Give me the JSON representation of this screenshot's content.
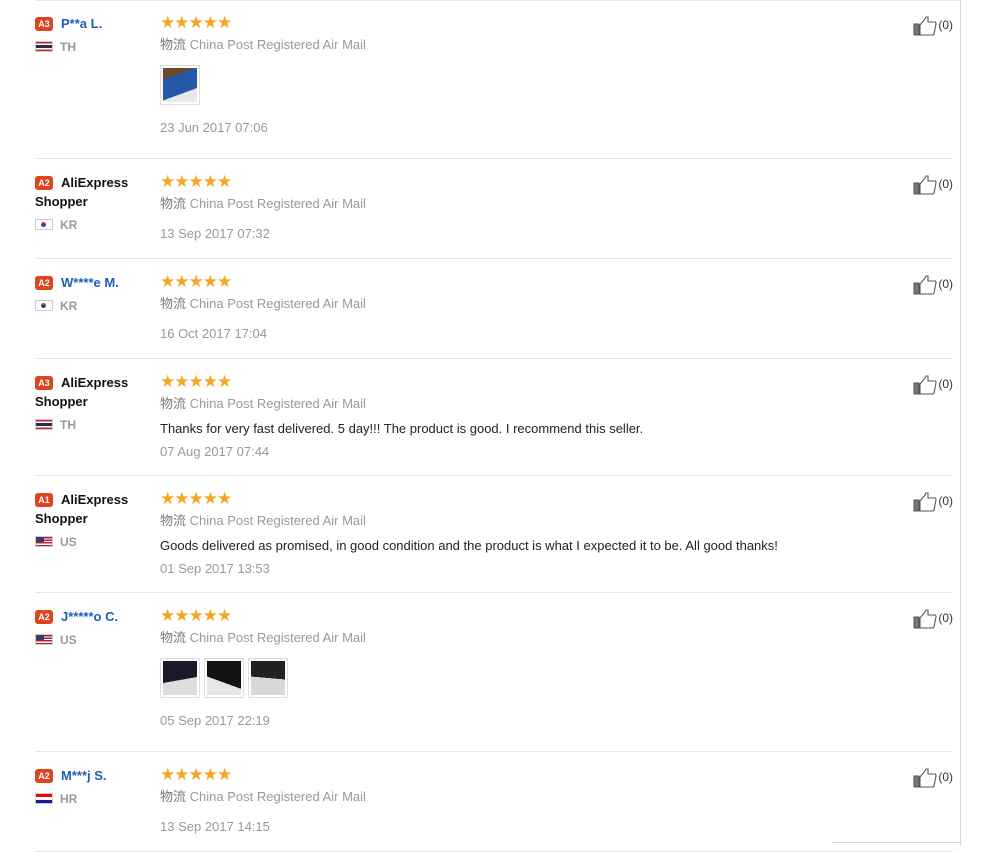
{
  "colors": {
    "level_badge": "#e0431f",
    "star": "#f5a623",
    "link_name": "#1d5fb5"
  },
  "reviews": [
    {
      "level": "A3",
      "name": "P**a L.",
      "name_style": "link",
      "country": "TH",
      "flag": "th",
      "stars": "★★★★★",
      "ship_cn": "物流",
      "ship": "China Post Registered Air Mail",
      "text": "",
      "photos": [
        "img-a"
      ],
      "date": "23 Jun 2017 07:06",
      "likes": "(0)"
    },
    {
      "level": "A2",
      "name": "AliExpress Shopper",
      "name_style": "plain",
      "country": "KR",
      "flag": "kr",
      "stars": "★★★★★",
      "ship_cn": "物流",
      "ship": "China Post Registered Air Mail",
      "text": "",
      "photos": [],
      "date": "13 Sep 2017 07:32",
      "likes": "(0)"
    },
    {
      "level": "A2",
      "name": "W****e M.",
      "name_style": "link",
      "country": "KR",
      "flag": "kr",
      "stars": "★★★★★",
      "ship_cn": "物流",
      "ship": "China Post Registered Air Mail",
      "text": "",
      "photos": [],
      "date": "16 Oct 2017 17:04",
      "likes": "(0)"
    },
    {
      "level": "A3",
      "name": "AliExpress Shopper",
      "name_style": "plain",
      "country": "TH",
      "flag": "th",
      "stars": "★★★★★",
      "ship_cn": "物流",
      "ship": "China Post Registered Air Mail",
      "text": "Thanks for very fast delivered. 5 day!!! The product is good. I recommend this seller.",
      "photos": [],
      "date": "07 Aug 2017 07:44",
      "likes": "(0)"
    },
    {
      "level": "A1",
      "name": "AliExpress Shopper",
      "name_style": "plain",
      "country": "US",
      "flag": "us",
      "stars": "★★★★★",
      "ship_cn": "物流",
      "ship": "China Post Registered Air Mail",
      "text": "Goods delivered as promised, in good condition and the product is what I expected it to be. All good thanks!",
      "photos": [],
      "date": "01 Sep 2017 13:53",
      "likes": "(0)"
    },
    {
      "level": "A2",
      "name": "J*****o C.",
      "name_style": "link",
      "country": "US",
      "flag": "us",
      "stars": "★★★★★",
      "ship_cn": "物流",
      "ship": "China Post Registered Air Mail",
      "text": "",
      "photos": [
        "img-b",
        "img-c",
        "img-d"
      ],
      "date": "05 Sep 2017 22:19",
      "likes": "(0)"
    },
    {
      "level": "A2",
      "name": "M***j S.",
      "name_style": "link",
      "country": "HR",
      "flag": "hr",
      "stars": "★★★★★",
      "ship_cn": "物流",
      "ship": "China Post Registered Air Mail",
      "text": "",
      "photos": [],
      "date": "13 Sep 2017 14:15",
      "likes": "(0)"
    }
  ]
}
